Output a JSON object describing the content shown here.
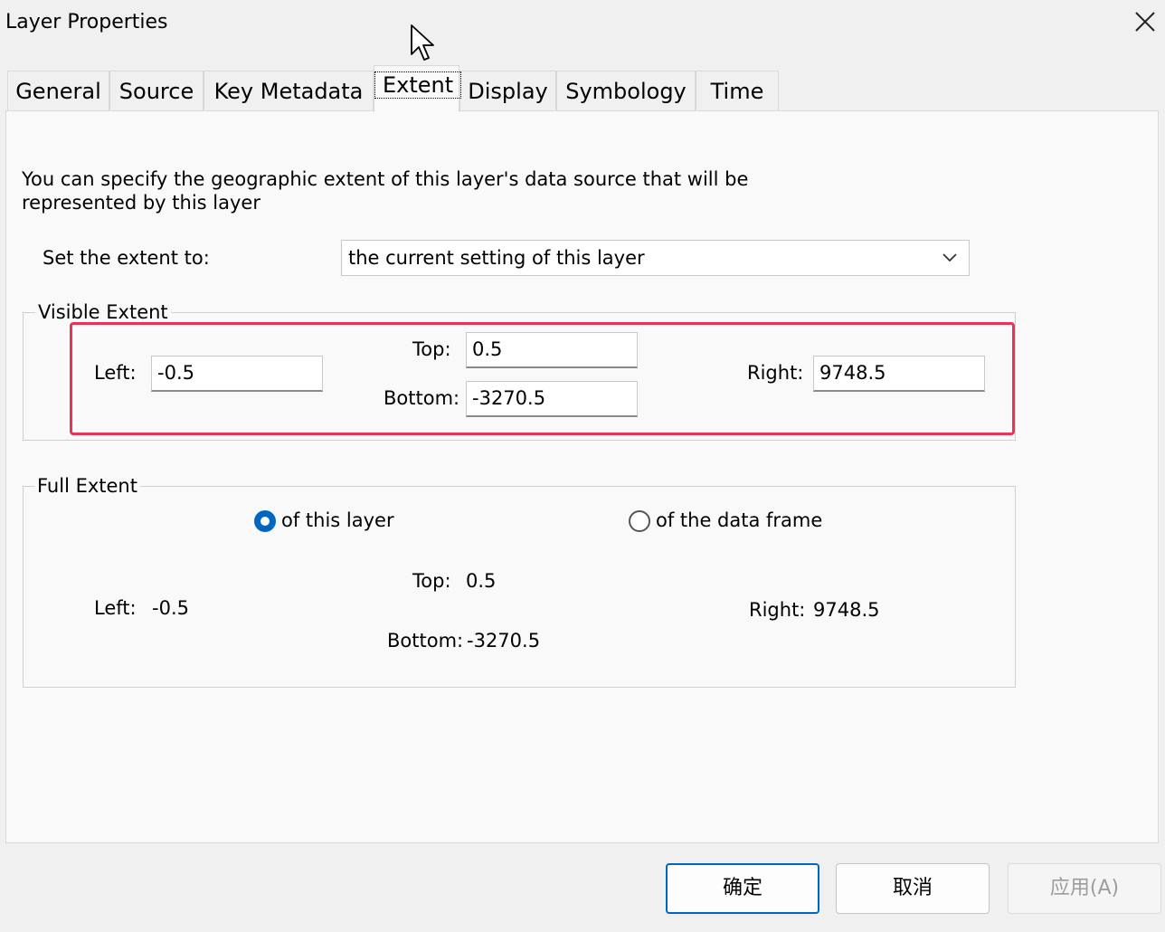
{
  "window": {
    "title": "Layer Properties"
  },
  "tabs": [
    {
      "label": "General"
    },
    {
      "label": "Source"
    },
    {
      "label": "Key Metadata"
    },
    {
      "label": "Extent"
    },
    {
      "label": "Display"
    },
    {
      "label": "Symbology"
    },
    {
      "label": "Time"
    }
  ],
  "active_tab": "Extent",
  "extent": {
    "description": "You can specify the geographic extent of this layer's data source that will be represented by this layer",
    "set_extent_label": "Set the extent to:",
    "set_extent_value": "the current setting of this layer",
    "visible": {
      "title": "Visible Extent",
      "left_label": "Left:",
      "left_value": "-0.5",
      "top_label": "Top:",
      "top_value": "0.5",
      "bottom_label": "Bottom:",
      "bottom_value": "-3270.5",
      "right_label": "Right:",
      "right_value": "9748.5"
    },
    "full": {
      "title": "Full Extent",
      "option_layer": "of this layer",
      "option_frame": "of the data frame",
      "selected": "of this layer",
      "left_label": "Left:",
      "left_value": "-0.5",
      "top_label": "Top:",
      "top_value": "0.5",
      "bottom_label": "Bottom:",
      "bottom_value": "-3270.5",
      "right_label": "Right:",
      "right_value": "9748.5"
    }
  },
  "buttons": {
    "ok": "确定",
    "cancel": "取消",
    "apply": "应用(A)"
  },
  "colors": {
    "highlight": "#e8345a",
    "accent": "#0067c0"
  },
  "icons": {
    "close": "close-icon",
    "dropdown": "chevron-down-icon",
    "cursor": "mouse-pointer-icon"
  }
}
